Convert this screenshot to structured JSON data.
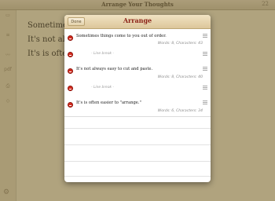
{
  "app": {
    "title": "Arrange Your Thoughts",
    "count": "22",
    "document_lines": [
      "Sometimes things come to you out of order.",
      "It's not always easy to cut and paste.",
      "It's is often easier to \"arrange.\""
    ]
  },
  "sidebar": {
    "icons": [
      "page-icon",
      "list-icon",
      "chart-icon",
      "pdf-icon",
      "print-icon",
      "tag-icon"
    ],
    "pdf_label": "pdf"
  },
  "popover": {
    "done_label": "Done",
    "title": "Arrange",
    "items": [
      {
        "type": "sentence",
        "text": "Sometimes things come to you out of order.",
        "stats": "Words: 8, Characters: 43"
      },
      {
        "type": "break",
        "text": "- Line break -"
      },
      {
        "type": "sentence",
        "text": "It's not always easy to cut and paste.",
        "stats": "Words: 8, Characters: 40"
      },
      {
        "type": "break",
        "text": "- Line break -"
      },
      {
        "type": "sentence",
        "text": "It's is often easier to \"arrange.\"",
        "stats": "Words: 6, Characters: 34"
      }
    ]
  }
}
